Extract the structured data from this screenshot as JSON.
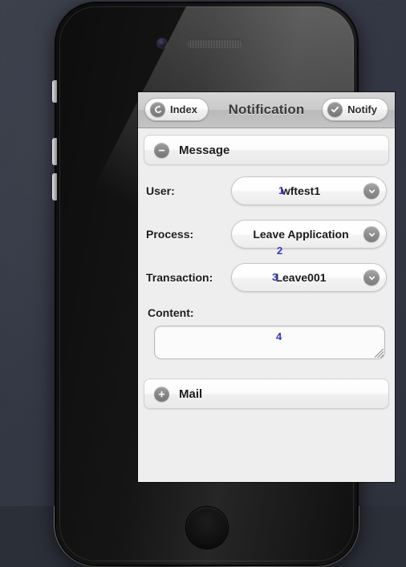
{
  "device": {
    "frame": "iphone-4",
    "elements": [
      "camera",
      "speaker",
      "silent-switch",
      "volume-up",
      "volume-down",
      "home-button"
    ]
  },
  "colors": {
    "backdrop": "#353a45",
    "toolbar_start": "#d6d6d6",
    "toolbar_end": "#c4c4c4",
    "screen_bg": "#eeeeee",
    "annotation_blue": "#3333cc",
    "label_text": "#1c1c1c",
    "icon_gray": "#8d8d8d"
  },
  "toolbar": {
    "title": "Notification",
    "back_button": {
      "label": "Index",
      "icon": "back-arrow-icon"
    },
    "action_button": {
      "label": "Notify",
      "icon": "check-circle-icon"
    }
  },
  "sections": {
    "message": {
      "title": "Message",
      "icon": "minus-circle-icon",
      "expanded": true
    },
    "mail": {
      "title": "Mail",
      "icon": "plus-circle-icon",
      "expanded": false
    }
  },
  "form": {
    "fields": [
      {
        "label": "User:",
        "value": "wftest1",
        "icon": "chevron-down-icon",
        "annotation": "1"
      },
      {
        "label": "Process:",
        "value": "Leave Application",
        "icon": "chevron-down-icon",
        "annotation": "2"
      },
      {
        "label": "Transaction:",
        "value": "Leave001",
        "icon": "chevron-down-icon",
        "annotation": "3"
      }
    ],
    "content": {
      "label": "Content:",
      "value": "",
      "placeholder": "",
      "annotation": "4"
    }
  }
}
